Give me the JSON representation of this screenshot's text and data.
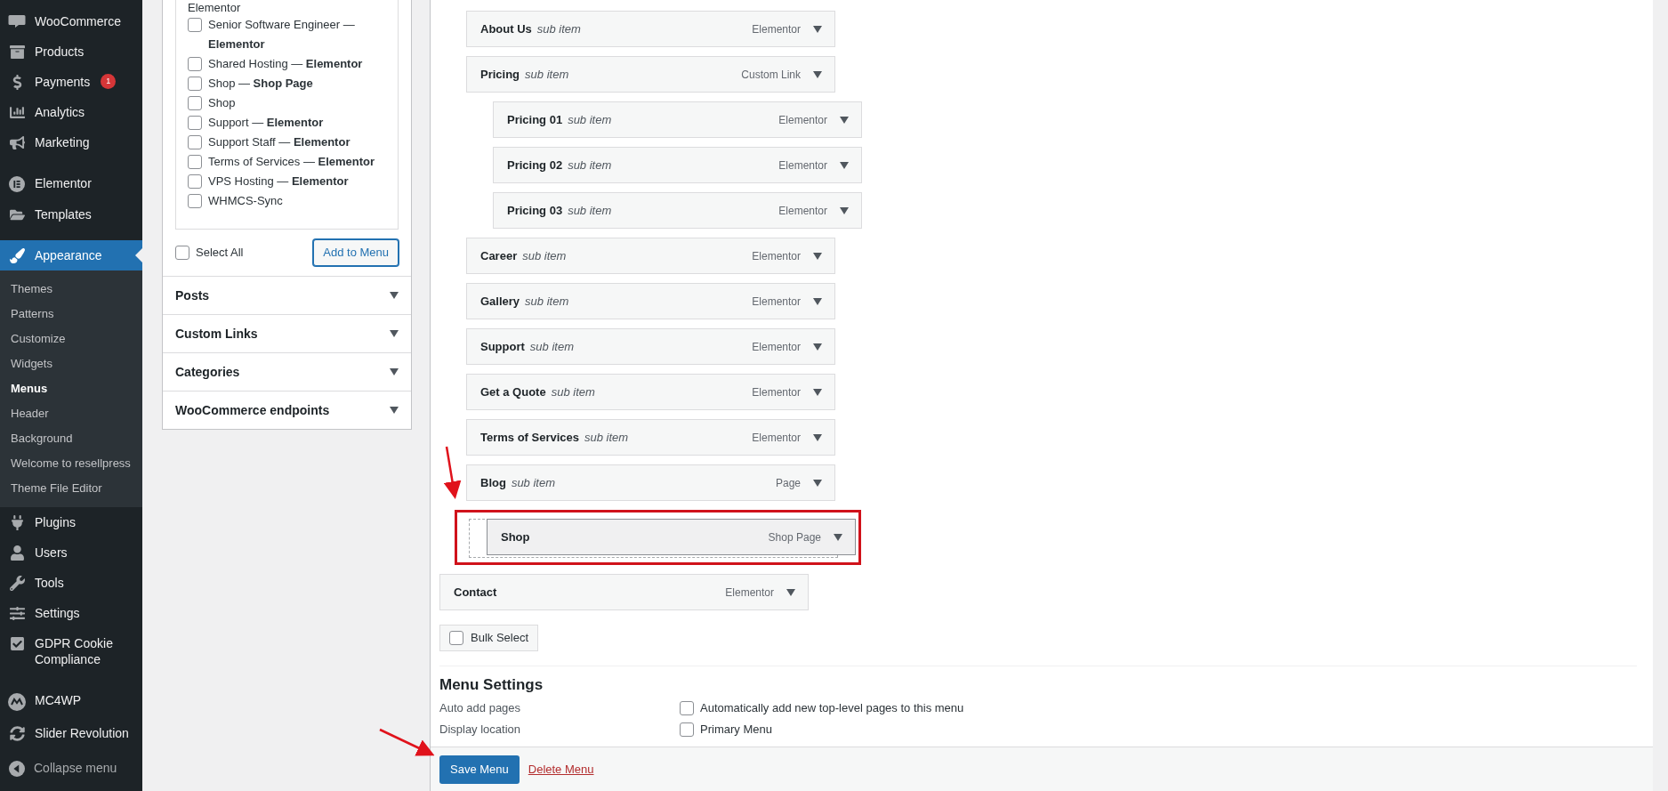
{
  "sidebar": {
    "groups": [
      {
        "items": [
          {
            "label": "WooCommerce",
            "selected": false
          },
          {
            "label": "Products",
            "selected": false
          },
          {
            "label": "Payments",
            "badge": "1",
            "selected": false
          },
          {
            "label": "Analytics",
            "selected": false
          },
          {
            "label": "Marketing",
            "selected": false
          }
        ]
      },
      {
        "items": [
          {
            "label": "Elementor",
            "selected": false
          },
          {
            "label": "Templates",
            "selected": false
          }
        ]
      },
      {
        "items": [
          {
            "label": "Appearance",
            "selected": true,
            "children": [
              {
                "label": "Themes",
                "selected": false
              },
              {
                "label": "Patterns",
                "selected": false
              },
              {
                "label": "Customize",
                "selected": false
              },
              {
                "label": "Widgets",
                "selected": false
              },
              {
                "label": "Menus",
                "selected": true
              },
              {
                "label": "Header",
                "selected": false
              },
              {
                "label": "Background",
                "selected": false
              },
              {
                "label": "Welcome to resellpress",
                "selected": false
              },
              {
                "label": "Theme File Editor",
                "selected": false
              }
            ]
          },
          {
            "label": "Plugins",
            "selected": false
          },
          {
            "label": "Users",
            "selected": false
          },
          {
            "label": "Tools",
            "selected": false
          },
          {
            "label": "Settings",
            "selected": false
          },
          {
            "label": "GDPR Cookie Compliance",
            "selected": false
          }
        ]
      },
      {
        "items": [
          {
            "label": "MC4WP",
            "selected": false
          },
          {
            "label": "Slider Revolution",
            "selected": false
          }
        ]
      }
    ],
    "collapse": "Collapse menu"
  },
  "add_items": {
    "pages": {
      "top_fragment": "Elementor",
      "items": [
        {
          "label": "Senior Software Engineer — **Elementor**",
          "checked": false
        },
        {
          "label": "Shared Hosting — **Elementor**",
          "checked": false
        },
        {
          "label": "Shop — **Shop Page**",
          "checked": false
        },
        {
          "label": "Shop",
          "checked": false
        },
        {
          "label": "Support — **Elementor**",
          "checked": false
        },
        {
          "label": "Support Staff — **Elementor**",
          "checked": false
        },
        {
          "label": "Terms of Services — **Elementor**",
          "checked": false
        },
        {
          "label": "VPS Hosting — **Elementor**",
          "checked": false
        },
        {
          "label": "WHMCS-Sync",
          "checked": false
        }
      ],
      "select_all": {
        "label": "Select All",
        "checked": false
      },
      "add_button": "Add to Menu"
    },
    "sections": [
      {
        "title": "Posts"
      },
      {
        "title": "Custom Links"
      },
      {
        "title": "Categories"
      },
      {
        "title": "WooCommerce endpoints"
      }
    ]
  },
  "menu_structure": {
    "items": [
      {
        "children": [
          {
            "title": "About Us",
            "subtitle": "sub item",
            "type": "Elementor"
          },
          {
            "title": "Pricing",
            "subtitle": "sub item",
            "type": "Custom Link",
            "children": [
              {
                "title": "Pricing 01",
                "subtitle": "sub item",
                "type": "Elementor"
              },
              {
                "title": "Pricing 02",
                "subtitle": "sub item",
                "type": "Elementor"
              },
              {
                "title": "Pricing 03",
                "subtitle": "sub item",
                "type": "Elementor"
              }
            ]
          },
          {
            "title": "Career",
            "subtitle": "sub item",
            "type": "Elementor"
          },
          {
            "title": "Gallery",
            "subtitle": "sub item",
            "type": "Elementor"
          },
          {
            "title": "Support",
            "subtitle": "sub item",
            "type": "Elementor"
          },
          {
            "title": "Get a Quote",
            "subtitle": "sub item",
            "type": "Elementor"
          },
          {
            "title": "Terms of Services",
            "subtitle": "sub item",
            "type": "Elementor"
          },
          {
            "title": "Blog",
            "subtitle": "sub item",
            "type": "Page"
          },
          {
            "title": "Shop",
            "type": "Shop Page",
            "dragging": true,
            "highlighted": true
          }
        ]
      },
      {
        "title": "Contact",
        "type": "Elementor"
      }
    ],
    "bulk_select": {
      "label": "Bulk Select",
      "checked": false
    }
  },
  "menu_settings": {
    "title": "Menu Settings",
    "rows": [
      {
        "label": "Auto add pages",
        "option": "Automatically add new top-level pages to this menu",
        "checked": false
      },
      {
        "label": "Display location",
        "option": "Primary Menu",
        "checked": false
      }
    ]
  },
  "footer": {
    "save": "Save Menu",
    "delete": "Delete Menu"
  },
  "annotations": [
    {
      "kind": "arrow"
    },
    {
      "kind": "arrow"
    }
  ]
}
